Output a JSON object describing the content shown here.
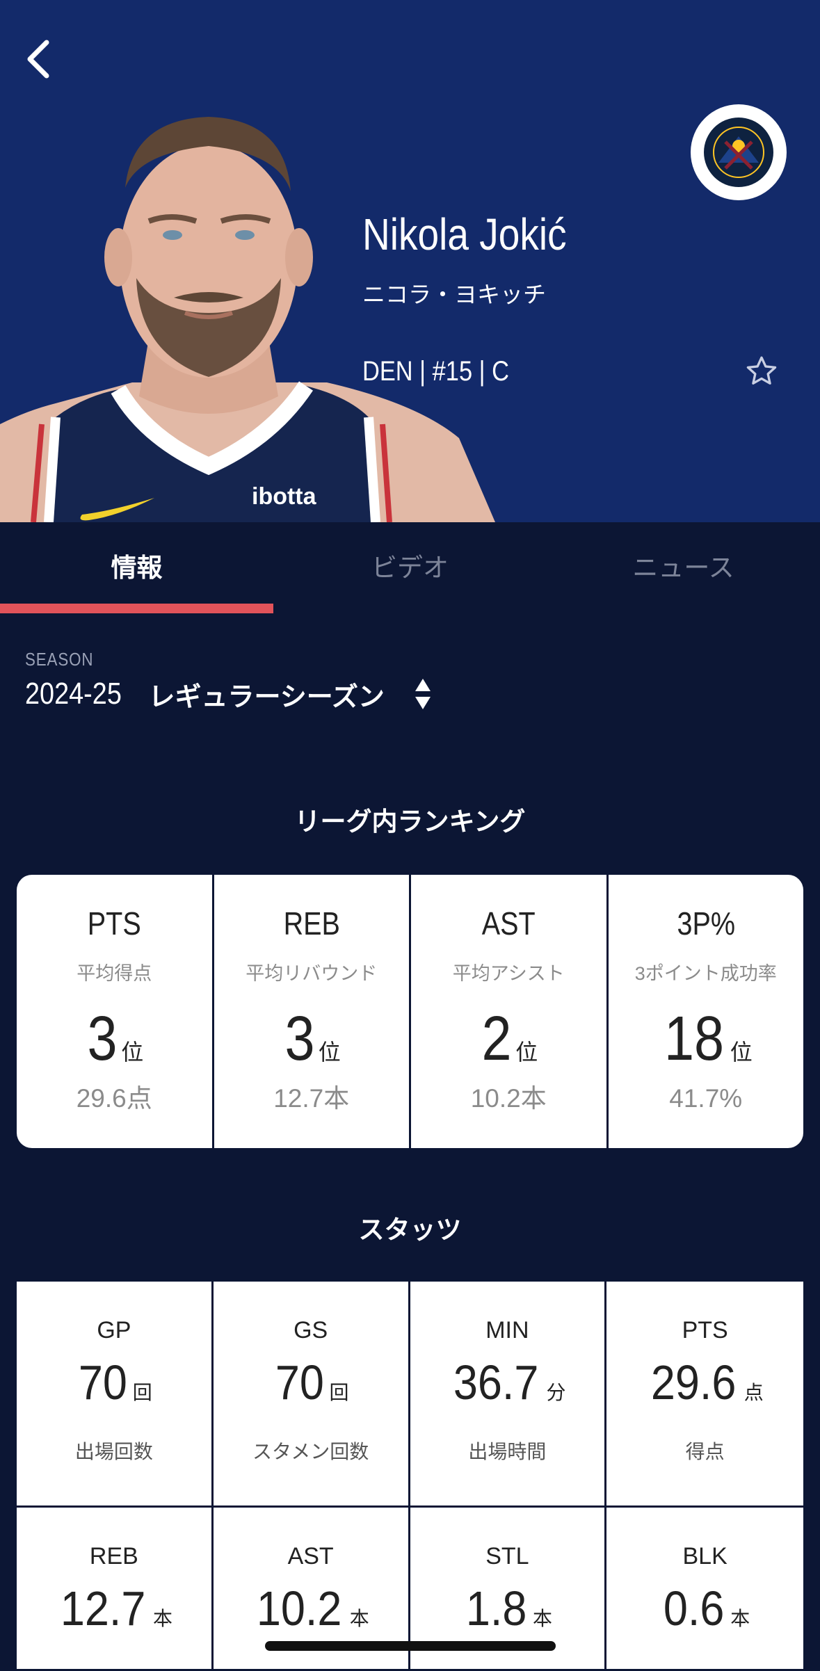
{
  "player": {
    "name_en": "Nikola Jokić",
    "name_ja": "ニコラ・ヨキッチ",
    "team_line": "DEN | #15 | C",
    "jersey_sponsor": "ibotta",
    "team_logo_text": "DENVER NUGGETS"
  },
  "tabs": [
    {
      "label": "情報",
      "active": true
    },
    {
      "label": "ビデオ",
      "active": false
    },
    {
      "label": "ニュース",
      "active": false
    }
  ],
  "season": {
    "caption": "SEASON",
    "year": "2024-25",
    "type": "レギュラーシーズン"
  },
  "ranking": {
    "title": "リーグ内ランキング",
    "rank_unit": "位",
    "items": [
      {
        "abbr": "PTS",
        "label": "平均得点",
        "rank": "3",
        "value": "29.6点"
      },
      {
        "abbr": "REB",
        "label": "平均リバウンド",
        "rank": "3",
        "value": "12.7本"
      },
      {
        "abbr": "AST",
        "label": "平均アシスト",
        "rank": "2",
        "value": "10.2本"
      },
      {
        "abbr": "3P%",
        "label": "3ポイント成功率",
        "rank": "18",
        "value": "41.7%"
      }
    ]
  },
  "stats": {
    "title": "スタッツ",
    "items": [
      {
        "abbr": "GP",
        "value": "70",
        "unit": "回",
        "label": "出場回数"
      },
      {
        "abbr": "GS",
        "value": "70",
        "unit": "回",
        "label": "スタメン回数"
      },
      {
        "abbr": "MIN",
        "value": "36.7",
        "unit": "分",
        "label": "出場時間"
      },
      {
        "abbr": "PTS",
        "value": "29.6",
        "unit": "点",
        "label": "得点"
      },
      {
        "abbr": "REB",
        "value": "12.7",
        "unit": "本",
        "label": ""
      },
      {
        "abbr": "AST",
        "value": "10.2",
        "unit": "本",
        "label": ""
      },
      {
        "abbr": "STL",
        "value": "1.8",
        "unit": "本",
        "label": ""
      },
      {
        "abbr": "BLK",
        "value": "0.6",
        "unit": "本",
        "label": ""
      }
    ]
  },
  "colors": {
    "hero_bg": "#132a6a",
    "page_bg": "#0c1634",
    "accent": "#e2535a",
    "nuggets_gold": "#fec524"
  },
  "icons": {
    "back": "chevron-left-icon",
    "favorite": "star-outline-icon",
    "season_select": "sort-updown-icon"
  }
}
